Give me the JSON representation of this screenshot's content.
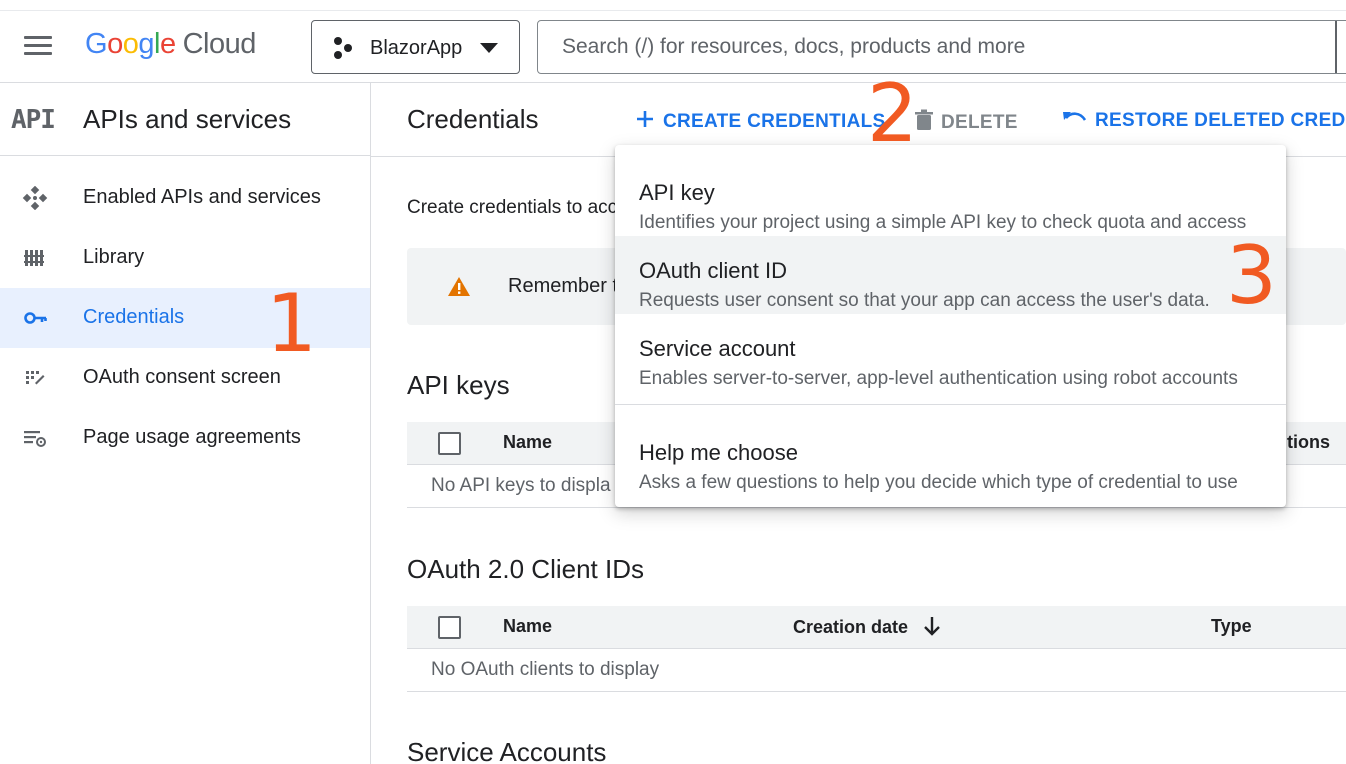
{
  "topbar": {
    "logo": {
      "google": "Google",
      "cloud": "Cloud"
    },
    "project": "BlazorApp",
    "search_placeholder": "Search (/) for resources, docs, products and more"
  },
  "sidebar": {
    "mark": "API",
    "title": "APIs and services",
    "items": [
      {
        "label": "Enabled APIs and services",
        "icon": "enabled-apis-icon"
      },
      {
        "label": "Library",
        "icon": "library-icon"
      },
      {
        "label": "Credentials",
        "icon": "key-icon",
        "active": true
      },
      {
        "label": "OAuth consent screen",
        "icon": "consent-icon"
      },
      {
        "label": "Page usage agreements",
        "icon": "agreements-icon"
      }
    ]
  },
  "main": {
    "title": "Credentials",
    "actions": {
      "create": "CREATE CREDENTIALS",
      "delete": "DELETE",
      "restore": "RESTORE DELETED CREDENT"
    },
    "intro": "Create credentials to acc",
    "banner": "Remember t",
    "api_keys": {
      "title": "API keys",
      "col_name": "Name",
      "col_actions": "tions",
      "empty": "No API keys to displa"
    },
    "oauth": {
      "title": "OAuth 2.0 Client IDs",
      "col_name": "Name",
      "col_date": "Creation date",
      "col_type": "Type",
      "empty": "No OAuth clients to display"
    },
    "service_accounts": {
      "title": "Service Accounts"
    }
  },
  "menu": {
    "items": [
      {
        "title": "API key",
        "desc": "Identifies your project using a simple API key to check quota and access"
      },
      {
        "title": "OAuth client ID",
        "desc": "Requests user consent so that your app can access the user's data."
      },
      {
        "title": "Service account",
        "desc": "Enables server-to-server, app-level authentication using robot accounts"
      },
      {
        "title": "Help me choose",
        "desc": "Asks a few questions to help you decide which type of credential to use"
      }
    ]
  },
  "annotations": {
    "step1": "1",
    "step2": "2",
    "step3": "3",
    "color": "#f15a22"
  },
  "colors": {
    "accent": "#1a73e8",
    "active_bg": "#e8f0fe",
    "warning": "#e37400"
  }
}
